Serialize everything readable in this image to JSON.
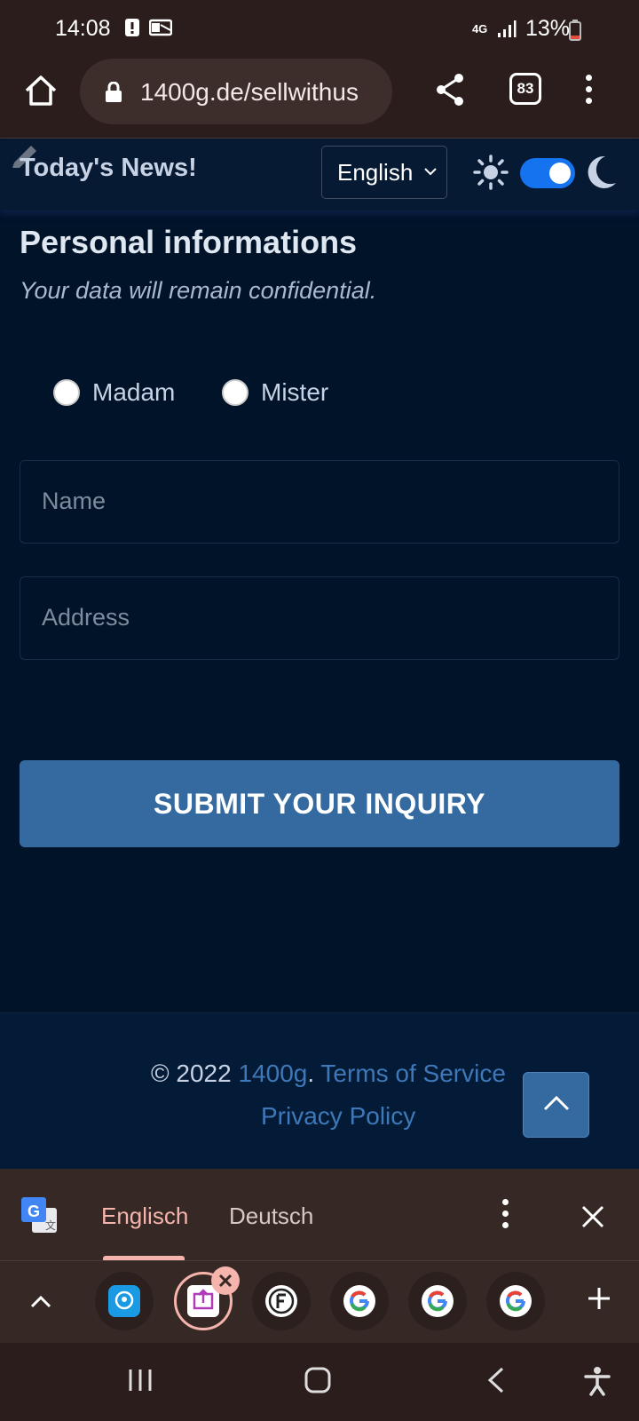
{
  "status_bar": {
    "time": "14:08",
    "network": "4G",
    "battery": "13%"
  },
  "browser": {
    "url": "1400g.de/sellwithus",
    "tab_count": "83"
  },
  "header": {
    "news_title": "Today's News!",
    "language": "English",
    "dark_mode_on": true
  },
  "form": {
    "title": "Personal informations",
    "subtitle": "Your data will remain confidential.",
    "salutations": [
      "Madam",
      "Mister"
    ],
    "name_placeholder": "Name",
    "address_placeholder": "Address",
    "submit_label": "SUBMIT YOUR INQUIRY"
  },
  "footer": {
    "copyright": "© 2022",
    "brand": "1400g",
    "separator": ".",
    "terms": "Terms of Service",
    "privacy": "Privacy Policy"
  },
  "translate_bar": {
    "source_lang": "Englisch",
    "target_lang": "Deutsch"
  },
  "colors": {
    "page_bg": "#001329",
    "accent": "#356aa0",
    "link": "#3f78b8",
    "toggle": "#1573f0",
    "translate_accent": "#f5b4ac"
  }
}
